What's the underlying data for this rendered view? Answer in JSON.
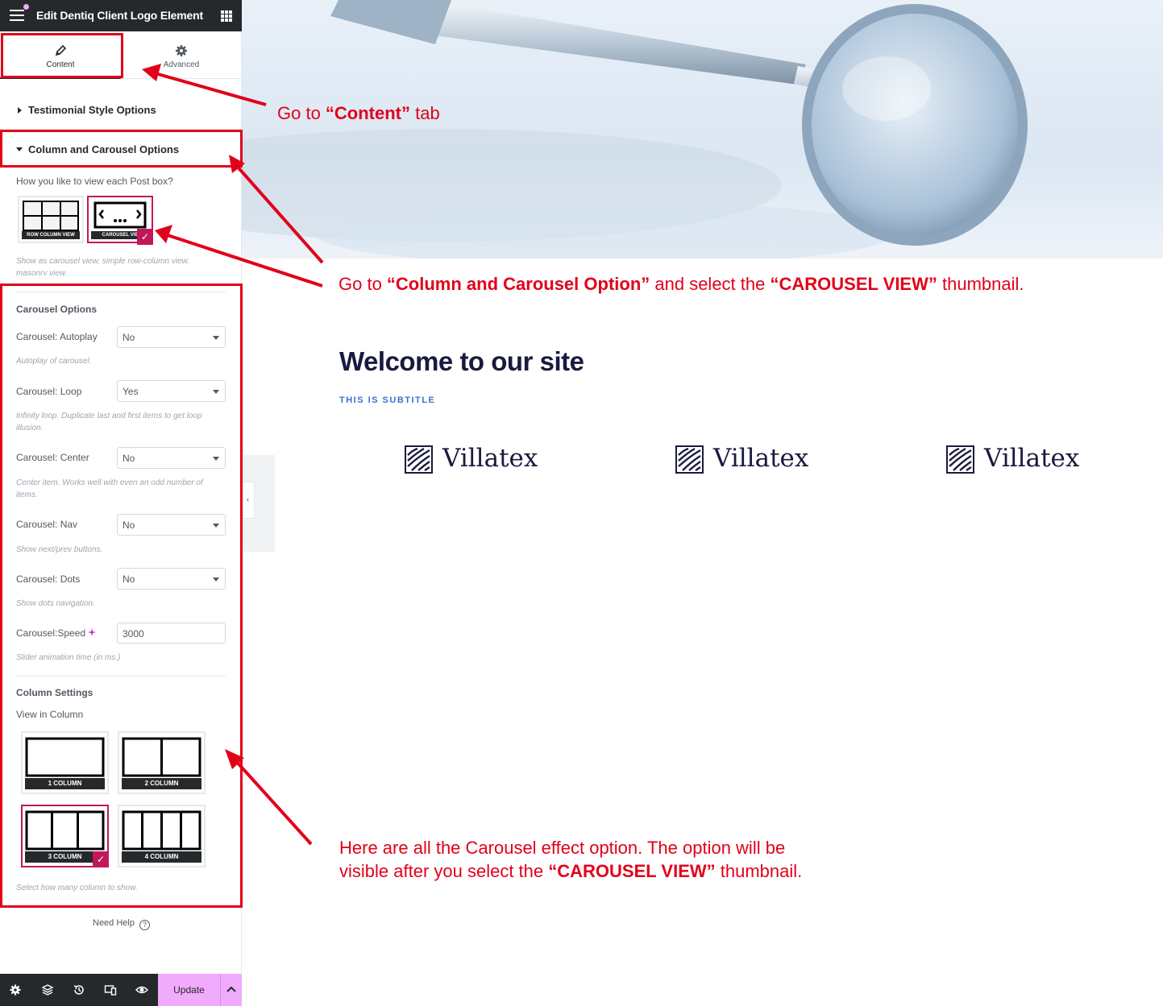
{
  "header": {
    "title": "Edit Dentiq Client Logo Element"
  },
  "tabs": [
    {
      "label": "Content"
    },
    {
      "label": "Advanced"
    }
  ],
  "sections": {
    "testimonial": "Testimonial Style Options",
    "column_carousel": "Column and Carousel Options"
  },
  "view_mode": {
    "question": "How you like to view each Post box?",
    "options": [
      {
        "label": "ROW COLUMN VIEW"
      },
      {
        "label": "CAROUSEL VIEW",
        "display": "CAROUSEL VIE"
      }
    ],
    "help": "Show as carousel view, simple row-column view.",
    "help_cut": "masonry view."
  },
  "carousel": {
    "heading": "Carousel Options",
    "autoplay": {
      "label": "Carousel: Autoplay",
      "value": "No",
      "help": "Autoplay of carousel."
    },
    "loop": {
      "label": "Carousel: Loop",
      "value": "Yes",
      "help1": "Infinity loop. Duplicate last and first items to get loop",
      "help2": "illusion."
    },
    "center": {
      "label": "Carousel: Center",
      "value": "No",
      "help1": "Center item. Works well with even an odd number of",
      "help2": "items."
    },
    "nav": {
      "label": "Carousel: Nav",
      "value": "No",
      "help": "Show next/prev buttons."
    },
    "dots": {
      "label": "Carousel: Dots",
      "value": "No",
      "help": "Show dots navigation."
    },
    "speed": {
      "label": "Carousel:Speed",
      "value": "3000",
      "help": "Slider animation time (in ms.)"
    }
  },
  "columns": {
    "heading": "Column Settings",
    "label": "View in Column",
    "options": [
      "1 COLUMN",
      "2 COLUMN",
      "3 COLUMN",
      "4 COLUMN"
    ],
    "help": "Select how many column to show."
  },
  "footer": {
    "need_help": "Need Help",
    "update": "Update"
  },
  "preview": {
    "title": "Welcome to our site",
    "subtitle": "THIS IS SUBTITLE",
    "logos": [
      "Villatex",
      "Villatex",
      "Villatex"
    ]
  },
  "annotations": {
    "a1": {
      "pre": "Go  to ",
      "bold": "“Content”",
      "post": " tab"
    },
    "a2": {
      "pre": "Go to ",
      "bold1": "“Column and Carousel Option”",
      "mid": " and select the ",
      "bold2": "“CAROUSEL VIEW”",
      "post": " thumbnail."
    },
    "a3": {
      "line1": "Here are all the Carousel effect option. The option will be",
      "line2_pre": "visible after you select the ",
      "line2_bold": "“CAROUSEL VIEW”",
      "line2_post": " thumbnail."
    }
  },
  "colors": {
    "accent": "#c2185b",
    "update": "#f0abfc",
    "annotation": "#e2001a",
    "dark": "#26292c"
  }
}
